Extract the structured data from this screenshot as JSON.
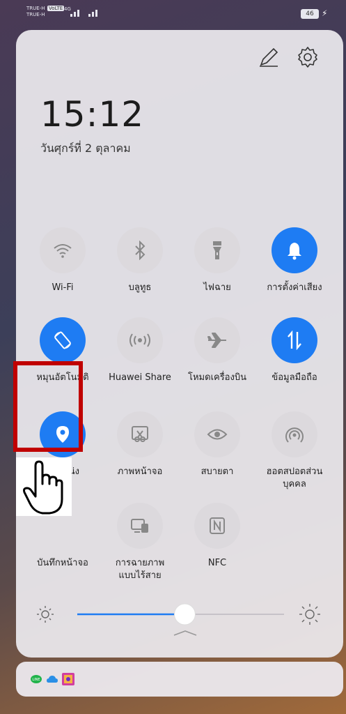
{
  "status_bar": {
    "carrier_1": "TRUE-H",
    "carrier_2": "TRUE-H",
    "volte_badge": "VoLTE",
    "network_type": "4G",
    "battery_level": "46"
  },
  "header": {
    "time": "15:12",
    "date": "วันศุกร์ที่ 2 ตุลาคม"
  },
  "tiles": [
    {
      "id": "wifi",
      "label": "Wi-Fi",
      "icon": "wifi-icon",
      "on": false
    },
    {
      "id": "bluetooth",
      "label": "บลูทูธ",
      "icon": "bluetooth-icon",
      "on": false
    },
    {
      "id": "flashlight",
      "label": "ไฟฉาย",
      "icon": "flashlight-icon",
      "on": false
    },
    {
      "id": "sound",
      "label": "การตั้งค่าเสียง",
      "icon": "bell-icon",
      "on": true
    },
    {
      "id": "autorotate",
      "label": "หมุนอัตโนมัติ",
      "icon": "rotate-icon",
      "on": true
    },
    {
      "id": "huawei-share",
      "label": "Huawei Share",
      "icon": "share-waves-icon",
      "on": false
    },
    {
      "id": "airplane",
      "label": "โหมดเครื่องบิน",
      "icon": "airplane-icon",
      "on": false
    },
    {
      "id": "mobile-data",
      "label": "ข้อมูลมือถือ",
      "icon": "data-arrows-icon",
      "on": true
    },
    {
      "id": "location",
      "label": "ตำแหน่ง",
      "icon": "location-pin-icon",
      "on": true
    },
    {
      "id": "screenshot",
      "label": "ภาพหน้าจอ",
      "icon": "scissors-screen-icon",
      "on": false
    },
    {
      "id": "eye-comfort",
      "label": "สบายตา",
      "icon": "eye-icon",
      "on": false
    },
    {
      "id": "hotspot",
      "label": "ฮอตสปอตส่วน\nบุคคล",
      "icon": "hotspot-icon",
      "on": false
    },
    {
      "id": "screen-record",
      "label": "บันทึกหน้าจอ",
      "icon": "record-icon",
      "on": false
    },
    {
      "id": "wireless-projection",
      "label": "การฉายภาพ\nแบบไร้สาย",
      "icon": "projection-icon",
      "on": false
    },
    {
      "id": "nfc",
      "label": "NFC",
      "icon": "nfc-icon",
      "on": false
    }
  ],
  "brightness": {
    "level": 0.52
  },
  "notification_bar": {
    "icons": [
      "line-icon",
      "cloud-icon",
      "game-app-icon"
    ]
  },
  "colors": {
    "accent": "#1e7cf3",
    "highlight": "#c00000",
    "tile_off": "#dcd9dd"
  }
}
